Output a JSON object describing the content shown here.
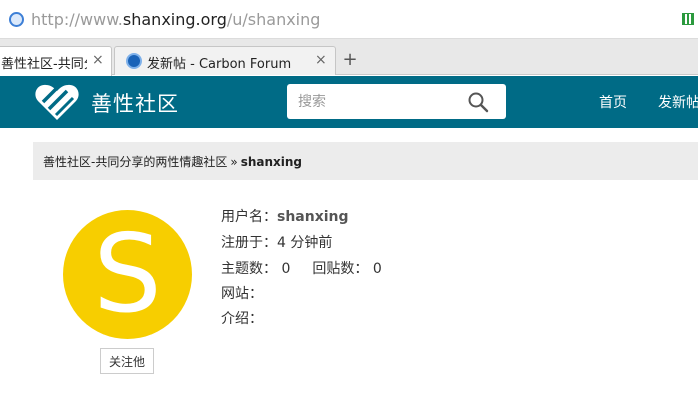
{
  "browser": {
    "address": {
      "scheme": "http://www.",
      "host": "shanxing.org",
      "path": "/u/shanxing"
    },
    "tabs": [
      {
        "title": "善性社区-共同分享",
        "close": "×",
        "active": true
      },
      {
        "title": "发新帖 - Carbon Forum",
        "close": "×",
        "active": false
      }
    ],
    "new_tab": "+"
  },
  "header": {
    "site_name": "善性社区",
    "search_placeholder": "搜索",
    "nav": [
      "首页",
      "发新帖"
    ],
    "bg_color": "#006b86"
  },
  "breadcrumb": {
    "home": "善性社区-共同分享的两性情趣社区",
    "separator": "»",
    "current": "shanxing"
  },
  "profile": {
    "avatar_letter": "S",
    "avatar_color": "#f7ce00",
    "follow_label": "关注他",
    "username_label": "用户名：",
    "username": "shanxing",
    "registered_label": "注册于：",
    "registered": "4 分钟前",
    "topics_label": "主题数：",
    "topics": "0",
    "replies_label": "回贴数：",
    "replies": "0",
    "website_label": "网站：",
    "bio_label": "介绍："
  }
}
